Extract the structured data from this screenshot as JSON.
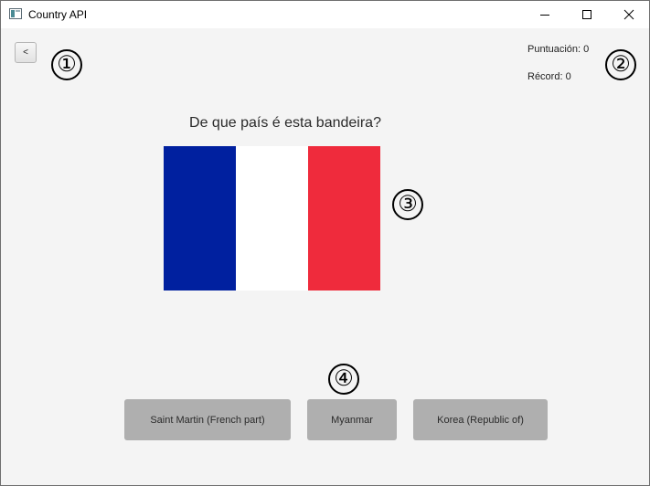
{
  "window": {
    "title": "Country API",
    "icons": {
      "app": "window-app-icon",
      "minimize": "minimize-icon",
      "maximize": "maximize-icon",
      "close": "close-icon"
    }
  },
  "nav": {
    "back_label": "<"
  },
  "score": {
    "score_text": "Puntuación: 0",
    "record_text": "Récord: 0"
  },
  "question": {
    "text": "De que país é esta bandeira?"
  },
  "flag": {
    "colors": [
      "#00209f",
      "#ffffff",
      "#ef2b3c"
    ]
  },
  "answers": [
    {
      "label": "Saint Martin (French part)"
    },
    {
      "label": "Myanmar"
    },
    {
      "label": "Korea (Republic of)"
    }
  ],
  "callouts": [
    "①",
    "②",
    "③",
    "④"
  ],
  "colors": {
    "answer_bg": "#afafaf",
    "window_bg": "#f4f4f4"
  }
}
